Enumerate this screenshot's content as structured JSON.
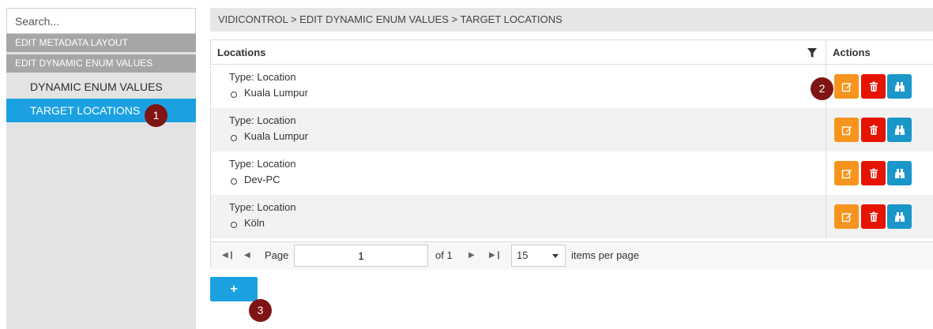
{
  "sidebar": {
    "search_placeholder": "Search...",
    "groups": [
      {
        "label": "EDIT METADATA LAYOUT"
      },
      {
        "label": "EDIT DYNAMIC ENUM VALUES"
      }
    ],
    "items": [
      {
        "label": "DYNAMIC ENUM VALUES",
        "active": false
      },
      {
        "label": "TARGET LOCATIONS",
        "active": true
      }
    ]
  },
  "markers": {
    "m1": "1",
    "m2": "2",
    "m3": "3"
  },
  "breadcrumb": "VIDICONTROL > EDIT DYNAMIC ENUM VALUES > TARGET LOCATIONS",
  "grid": {
    "columns": {
      "locations": "Locations",
      "actions": "Actions"
    },
    "rows": [
      {
        "type": "Type: Location",
        "value": "Kuala Lumpur"
      },
      {
        "type": "Type: Location",
        "value": "Kuala Lumpur"
      },
      {
        "type": "Type: Location",
        "value": "Dev-PC"
      },
      {
        "type": "Type: Location",
        "value": "Köln"
      }
    ],
    "action_icons": [
      "edit-icon",
      "delete-icon",
      "binoculars-icon"
    ]
  },
  "pager": {
    "page_label": "Page",
    "page_value": "1",
    "of_label": "of 1",
    "per_page": "15",
    "per_page_label": "items per page"
  },
  "add_button": {
    "label": "+"
  },
  "colors": {
    "accent": "#1ba1e2",
    "edit": "#f7941d",
    "delete": "#e51400",
    "view": "#1a96c8",
    "marker": "#7e1414"
  }
}
